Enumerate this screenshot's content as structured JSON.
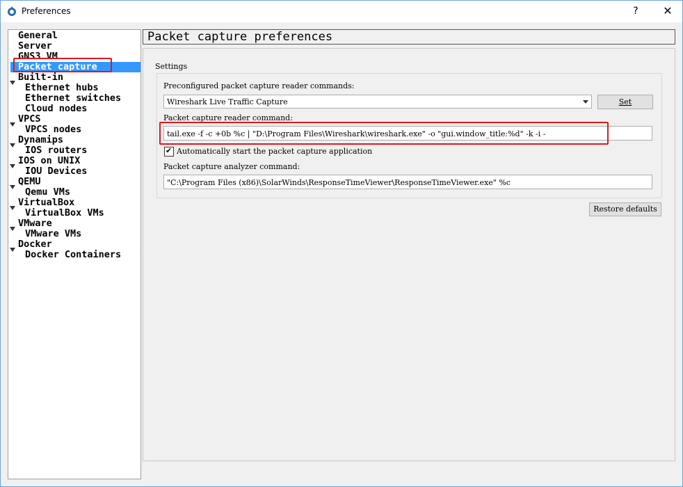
{
  "window": {
    "title": "Preferences",
    "help_label": "?",
    "close_label": "✕"
  },
  "sidebar": {
    "items": [
      {
        "label": "General"
      },
      {
        "label": "Server"
      },
      {
        "label": "GNS3 VM"
      },
      {
        "label": "Packet capture"
      },
      {
        "label": "Built-in"
      },
      {
        "label": "Ethernet hubs"
      },
      {
        "label": "Ethernet switches"
      },
      {
        "label": "Cloud nodes"
      },
      {
        "label": "VPCS"
      },
      {
        "label": "VPCS nodes"
      },
      {
        "label": "Dynamips"
      },
      {
        "label": "IOS routers"
      },
      {
        "label": "IOS on UNIX"
      },
      {
        "label": "IOU Devices"
      },
      {
        "label": "QEMU"
      },
      {
        "label": "Qemu VMs"
      },
      {
        "label": "VirtualBox"
      },
      {
        "label": "VirtualBox VMs"
      },
      {
        "label": "VMware"
      },
      {
        "label": "VMware VMs"
      },
      {
        "label": "Docker"
      },
      {
        "label": "Docker Containers"
      }
    ]
  },
  "page": {
    "title": "Packet capture preferences",
    "group_label": "Settings",
    "preconfigured_label": "Preconfigured packet capture reader commands:",
    "preconfigured_value": "Wireshark Live Traffic Capture",
    "set_button": "Set",
    "reader_label": "Packet capture reader command:",
    "reader_value": "tail.exe -f -c +0b %c | \"D:\\Program Files\\Wireshark\\wireshark.exe\" -o \"gui.window_title:%d\" -k -i -",
    "auto_start_label": "Automatically start the packet capture application",
    "auto_start_checked": "✔",
    "analyzer_label": "Packet capture analyzer command:",
    "analyzer_value": "\"C:\\Program Files (x86)\\SolarWinds\\ResponseTimeViewer\\ResponseTimeViewer.exe\" %c",
    "restore_button": "Restore defaults"
  },
  "colors": {
    "selection": "#3399ff",
    "highlight": "#e8141c",
    "window_border": "#6fa3d8"
  }
}
